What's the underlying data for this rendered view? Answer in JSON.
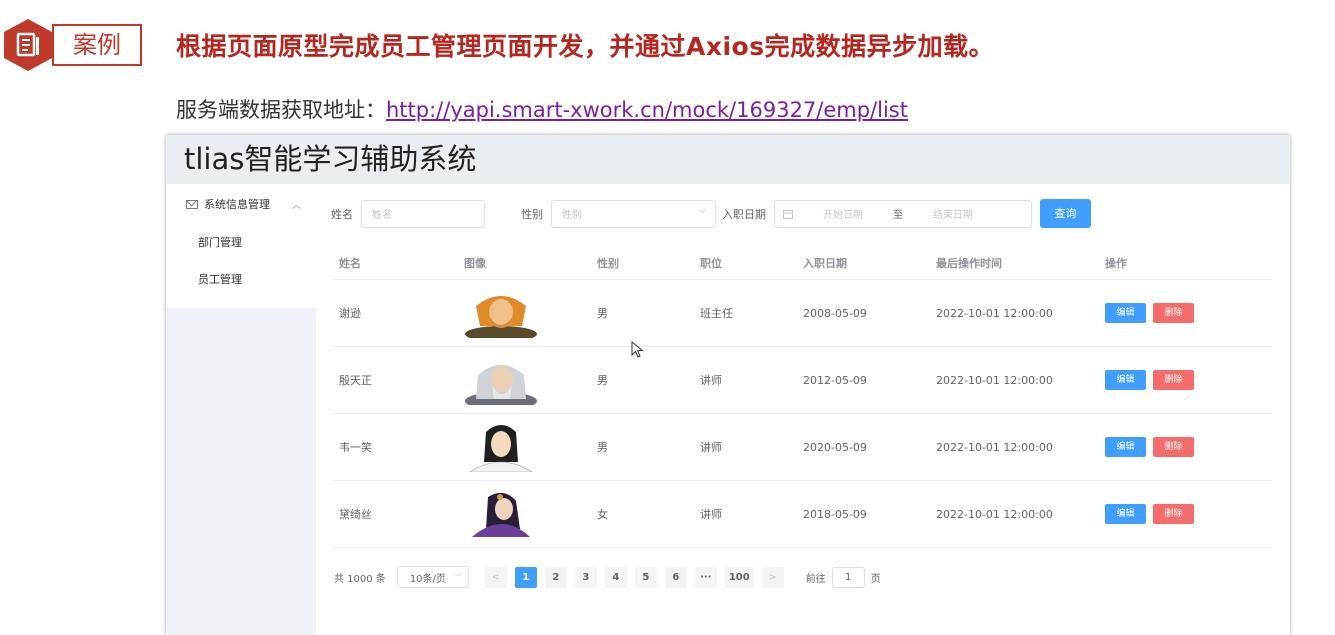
{
  "slide": {
    "badge_label": "案例",
    "headline": "根据页面原型完成员工管理页面开发，并通过Axios完成数据异步加载。",
    "url_prefix": "服务端数据获取地址：",
    "url": "http://yapi.smart-xwork.cn/mock/169327/emp/list"
  },
  "app": {
    "title": "tlias智能学习辅助系统",
    "menu": {
      "group_label": "系统信息管理",
      "items": [
        "部门管理",
        "员工管理"
      ]
    },
    "search": {
      "name_label": "姓名",
      "name_placeholder": "姓名",
      "gender_label": "性别",
      "gender_placeholder": "性别",
      "date_label": "入职日期",
      "start_placeholder": "开始日期",
      "range_sep": "至",
      "end_placeholder": "结束日期",
      "query_button": "查询"
    },
    "table": {
      "headers": [
        "姓名",
        "图像",
        "性别",
        "职位",
        "入职日期",
        "最后操作时间",
        "操作"
      ],
      "edit_label": "编辑",
      "delete_label": "删除",
      "rows": [
        {
          "name": "谢逊",
          "gender": "男",
          "job": "班主任",
          "entry_date": "2008-05-09",
          "update_time": "2022-10-01 12:00:00"
        },
        {
          "name": "殷天正",
          "gender": "男",
          "job": "讲师",
          "entry_date": "2012-05-09",
          "update_time": "2022-10-01 12:00:00"
        },
        {
          "name": "韦一笑",
          "gender": "男",
          "job": "讲师",
          "entry_date": "2020-05-09",
          "update_time": "2022-10-01 12:00:00"
        },
        {
          "name": "黛绮丝",
          "gender": "女",
          "job": "讲师",
          "entry_date": "2018-05-09",
          "update_time": "2022-10-01 12:00:00"
        }
      ]
    },
    "pagination": {
      "total": "共 1000 条",
      "page_size": "10条/页",
      "prev": "<",
      "pages": [
        "1",
        "2",
        "3",
        "4",
        "5",
        "6",
        "···",
        "100"
      ],
      "current": "1",
      "next": ">",
      "goto_label": "前往",
      "goto_value": "1",
      "goto_suffix": "页"
    }
  },
  "colors": {
    "accent": "#409eff",
    "danger": "#f56c6c",
    "slide_red": "#b5261e",
    "link": "#7b1fa2"
  }
}
